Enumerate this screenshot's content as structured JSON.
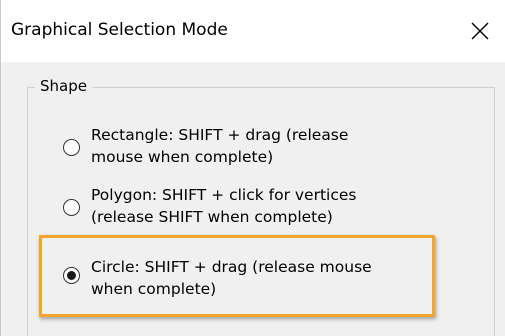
{
  "window": {
    "title": "Graphical Selection Mode",
    "close_icon": "close-icon"
  },
  "shape_group": {
    "legend": "Shape",
    "options": [
      {
        "line1": "Rectangle:  SHIFT + drag (release",
        "line2": "mouse when complete)",
        "selected": false
      },
      {
        "line1": "Polygon: SHIFT + click for vertices",
        "line2": "(release SHIFT when complete)",
        "selected": false
      },
      {
        "line1": "Circle: SHIFT + drag (release mouse",
        "line2": "when complete)",
        "selected": true
      }
    ]
  },
  "colors": {
    "highlight": "#f0a52c",
    "title_bar": "#ffffff",
    "dialog_bg": "#f0f0f0"
  }
}
